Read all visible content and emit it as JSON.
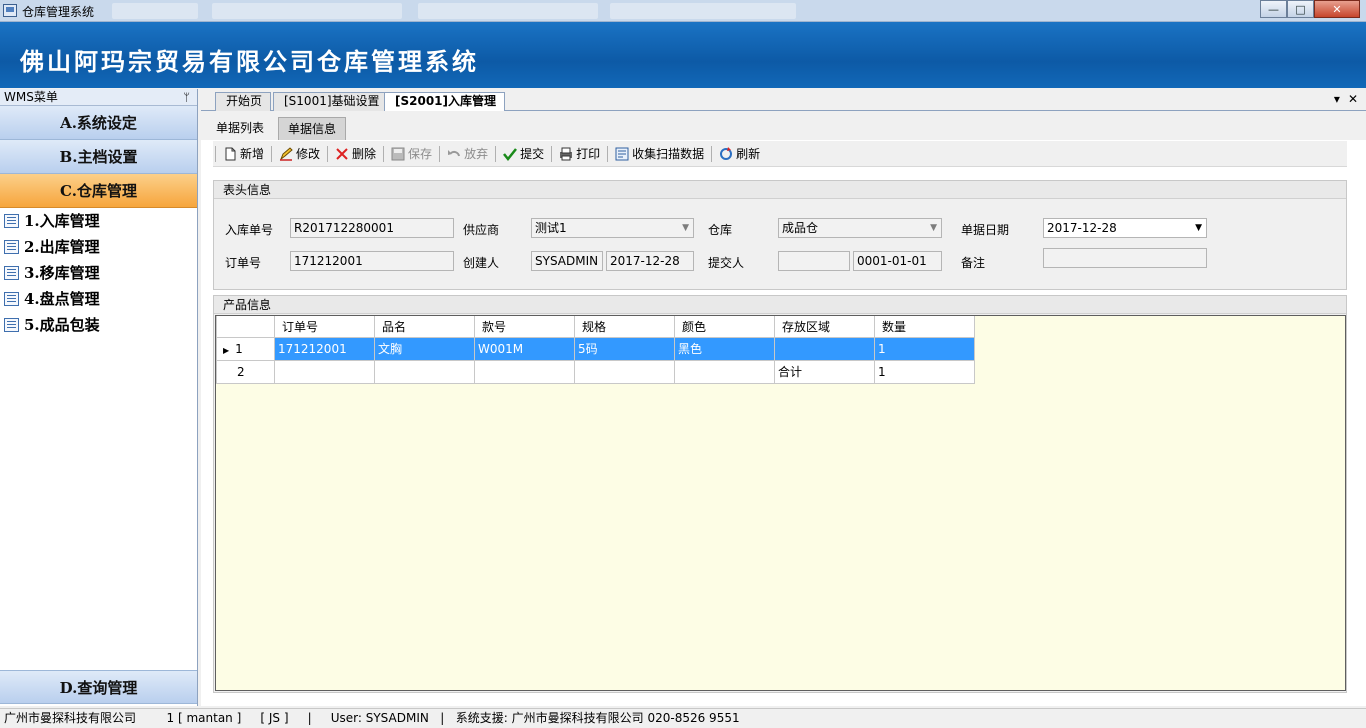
{
  "window": {
    "title": "仓库管理系统",
    "minimize": "—",
    "maximize": "□",
    "close": "✕"
  },
  "banner": {
    "title": "佛山阿玛宗贸易有限公司仓库管理系统"
  },
  "sidebar": {
    "header": "WMS菜单",
    "pin": "ᛘ",
    "groups": [
      {
        "label": "A.系统设定"
      },
      {
        "label": "B.主档设置"
      },
      {
        "label": "C.仓库管理"
      }
    ],
    "items": [
      {
        "label": "1.入库管理"
      },
      {
        "label": "2.出库管理"
      },
      {
        "label": "3.移库管理"
      },
      {
        "label": "4.盘点管理"
      },
      {
        "label": "5.成品包装"
      }
    ],
    "bottom_group": "D.查询管理"
  },
  "doc_tabs": [
    {
      "label": "开始页"
    },
    {
      "label": "[S1001]基础设置"
    },
    {
      "label": "[S2001]入库管理"
    }
  ],
  "tab_controls": {
    "dropdown": "▾",
    "close": "✕"
  },
  "sub_tabs": [
    {
      "label": "单据列表"
    },
    {
      "label": "单据信息"
    }
  ],
  "toolbar": {
    "new": "新增",
    "edit": "修改",
    "delete": "删除",
    "save": "保存",
    "discard": "放弃",
    "submit": "提交",
    "print": "打印",
    "collect_scan": "收集扫描数据",
    "refresh": "刷新"
  },
  "header_panel": {
    "title": "表头信息",
    "fields": {
      "inbound_no_label": "入库单号",
      "inbound_no": "R201712280001",
      "supplier_label": "供应商",
      "supplier": "测试1",
      "warehouse_label": "仓库",
      "warehouse": "成品仓",
      "doc_date_label": "单据日期",
      "doc_date": "2017-12-28",
      "order_no_label": "订单号",
      "order_no": "171212001",
      "creator_label": "创建人",
      "creator": "SYSADMIN",
      "create_date": "2017-12-28",
      "submitter_label": "提交人",
      "submitter": "",
      "submit_date": "0001-01-01",
      "remark_label": "备注",
      "remark": ""
    }
  },
  "product_panel": {
    "title": "产品信息",
    "columns": [
      "订单号",
      "品名",
      "款号",
      "规格",
      "颜色",
      "存放区域",
      "数量"
    ],
    "rows": [
      {
        "row": "1",
        "cells": [
          "171212001",
          "文胸",
          "W001M",
          "5码",
          "黑色",
          "",
          "1"
        ]
      },
      {
        "row": "2",
        "cells": [
          "",
          "",
          "",
          "",
          "",
          "合计",
          "1"
        ]
      }
    ]
  },
  "statusbar": {
    "company": "广州市曼探科技有限公司",
    "session": "1 [ mantan ]",
    "js": "[ JS ]",
    "sep": "|",
    "user": "User: SYSADMIN",
    "support": "系统支援: 广州市曼探科技有限公司 020-8526 9551"
  },
  "colors": {
    "banner": "#0d5aa6",
    "active_group": "#f6a53c",
    "selection": "#3399ff",
    "grid_bg": "#fdfde5"
  }
}
